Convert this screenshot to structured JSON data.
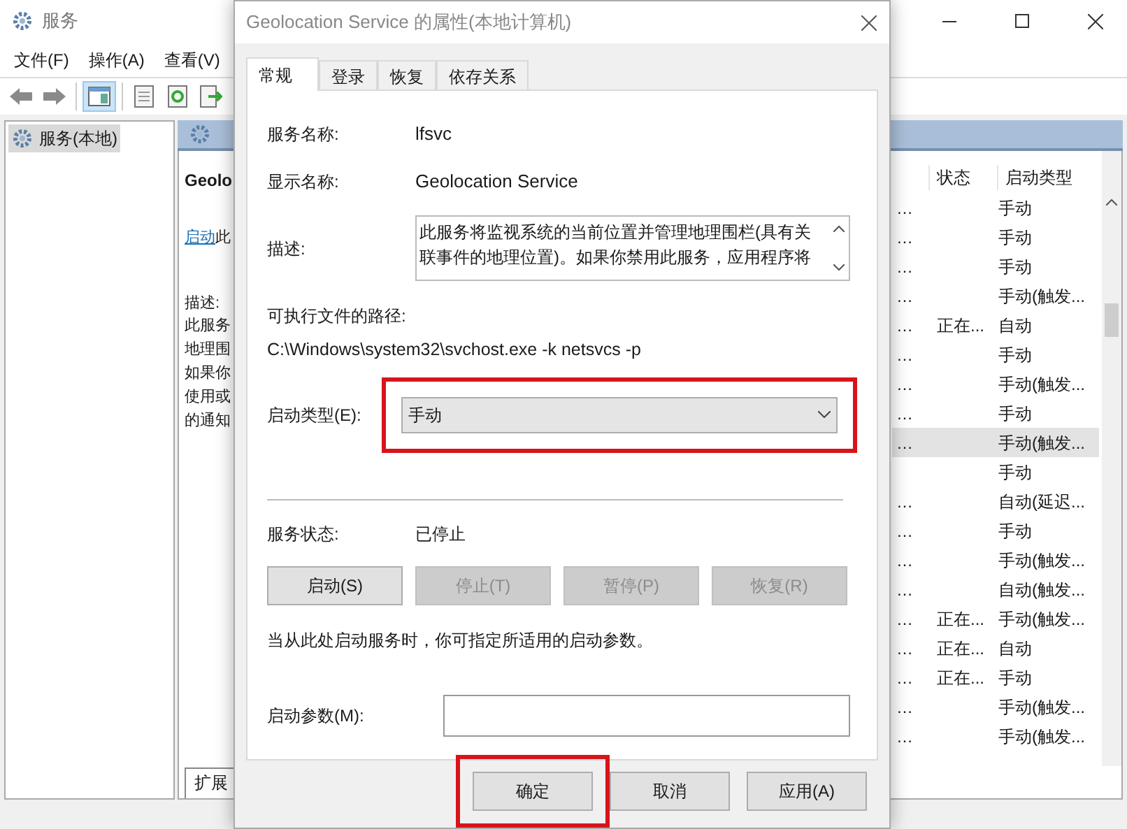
{
  "window": {
    "title": "服务",
    "menu": [
      "文件(F)",
      "操作(A)",
      "查看(V)"
    ]
  },
  "tree": {
    "items": [
      {
        "label": "服务(本地)",
        "selected": true
      }
    ]
  },
  "detail": {
    "title": "Geolo",
    "link": "启动",
    "link_tail": "此",
    "description_label": "描述:",
    "description_lines": [
      "此服务",
      "地理围",
      "如果你",
      "使用或",
      "的通知"
    ],
    "tab": "扩展"
  },
  "service_list": {
    "columns": [
      "状态",
      "启动类型"
    ],
    "rows": [
      {
        "column_1": "…",
        "status": "",
        "startup": "手动",
        "selected": false
      },
      {
        "column_1": "…",
        "status": "",
        "startup": "手动",
        "selected": false
      },
      {
        "column_1": "…",
        "status": "",
        "startup": "手动",
        "selected": false
      },
      {
        "column_1": "…",
        "status": "",
        "startup": "手动(触发...",
        "selected": false
      },
      {
        "column_1": "…",
        "status": "正在...",
        "startup": "自动",
        "selected": false
      },
      {
        "column_1": "…",
        "status": "",
        "startup": "手动",
        "selected": false
      },
      {
        "column_1": "…",
        "status": "",
        "startup": "手动(触发...",
        "selected": false
      },
      {
        "column_1": "…",
        "status": "",
        "startup": "手动",
        "selected": false
      },
      {
        "column_1": "…",
        "status": "",
        "startup": "手动(触发...",
        "selected": true
      },
      {
        "column_1": "",
        "status": "",
        "startup": "手动",
        "selected": false
      },
      {
        "column_1": "…",
        "status": "",
        "startup": "自动(延迟...",
        "selected": false
      },
      {
        "column_1": "…",
        "status": "",
        "startup": "手动",
        "selected": false
      },
      {
        "column_1": "…",
        "status": "",
        "startup": "手动(触发...",
        "selected": false
      },
      {
        "column_1": "…",
        "status": "",
        "startup": "自动(触发...",
        "selected": false
      },
      {
        "column_1": "…",
        "status": "正在...",
        "startup": "手动(触发...",
        "selected": false
      },
      {
        "column_1": "…",
        "status": "正在...",
        "startup": "自动",
        "selected": false
      },
      {
        "column_1": "…",
        "status": "正在...",
        "startup": "手动",
        "selected": false
      },
      {
        "column_1": "…",
        "status": "",
        "startup": "手动(触发...",
        "selected": false
      },
      {
        "column_1": "…",
        "status": "",
        "startup": "手动(触发...",
        "selected": false
      }
    ]
  },
  "dialog": {
    "title": "Geolocation Service 的属性(本地计算机)",
    "tabs": [
      {
        "label": "常规",
        "selected": true
      },
      {
        "label": "登录",
        "selected": false
      },
      {
        "label": "恢复",
        "selected": false
      },
      {
        "label": "依存关系",
        "selected": false
      }
    ],
    "service_name_label": "服务名称:",
    "service_name": "lfsvc",
    "display_name_label": "显示名称:",
    "display_name": "Geolocation Service",
    "description_label": "描述:",
    "description": "此服务将监视系统的当前位置并管理地理围栏(具有关联事件的地理位置)。如果你禁用此服务，应用程序将",
    "path_label": "可执行文件的路径:",
    "path": "C:\\Windows\\system32\\svchost.exe -k netsvcs -p",
    "startup_type_label": "启动类型(E):",
    "startup_type": {
      "value": "手动",
      "highlighted": true
    },
    "status_label": "服务状态:",
    "status": "已停止",
    "control_buttons": [
      {
        "label": "启动(S)",
        "disabled": false
      },
      {
        "label": "停止(T)",
        "disabled": true
      },
      {
        "label": "暂停(P)",
        "disabled": true
      },
      {
        "label": "恢复(R)",
        "disabled": true
      }
    ],
    "hint": "当从此处启动服务时，你可指定所适用的启动参数。",
    "params_label": "启动参数(M):",
    "buttons": [
      {
        "label": "确定",
        "highlighted": true
      },
      {
        "label": "取消",
        "highlighted": false
      },
      {
        "label": "应用(A)",
        "highlighted": false
      }
    ]
  }
}
